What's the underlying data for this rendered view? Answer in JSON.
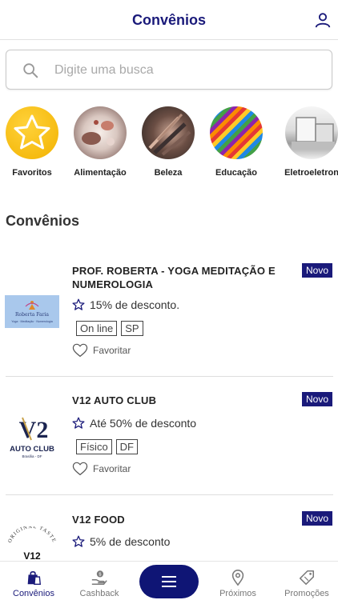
{
  "header": {
    "title": "Convênios"
  },
  "search": {
    "placeholder": "Digite uma busca"
  },
  "categories": [
    {
      "label": "Favoritos"
    },
    {
      "label": "Alimentação"
    },
    {
      "label": "Beleza"
    },
    {
      "label": "Educação"
    },
    {
      "label": "Eletroeletron"
    }
  ],
  "section": {
    "title": "Convênios"
  },
  "cards": [
    {
      "name": "PROF. ROBERTA - YOGA MEDITAÇÃO E NUMEROLOGIA",
      "badge": "Novo",
      "discount": "15% de desconto.",
      "tags": [
        "On line",
        "SP"
      ],
      "favorite": "Favoritar",
      "logo": {
        "line1": "Roberta Faria",
        "line2": "Yoga · Meditação · Numerologia"
      }
    },
    {
      "name": "V12 AUTO CLUB",
      "badge": "Novo",
      "discount": "Até 50% de desconto",
      "tags": [
        "Físico",
        "DF"
      ],
      "favorite": "Favoritar",
      "logo": {
        "mark": "V2",
        "line1": "AUTO CLUB",
        "line2": "Brasília - DF"
      }
    },
    {
      "name": "V12 FOOD",
      "badge": "Novo",
      "discount": "5% de desconto",
      "logo": {
        "arc": "ORIGINAL TASTE",
        "mark": "V12"
      }
    }
  ],
  "bottom_nav": {
    "items": [
      {
        "label": "Convênios",
        "icon": "shopping-bag-icon",
        "active": true
      },
      {
        "label": "Cashback",
        "icon": "hand-coin-icon",
        "active": false
      },
      {
        "label": "Próximos",
        "icon": "location-pin-icon",
        "active": false
      },
      {
        "label": "Promoções",
        "icon": "price-tag-icon",
        "active": false
      }
    ],
    "menu_icon": "menu-icon"
  },
  "colors": {
    "brand": "#1a1a7a",
    "badge_bg": "#1a1a7a",
    "fab_bg": "#0f1575",
    "favorites_yellow": "#f2b200"
  }
}
